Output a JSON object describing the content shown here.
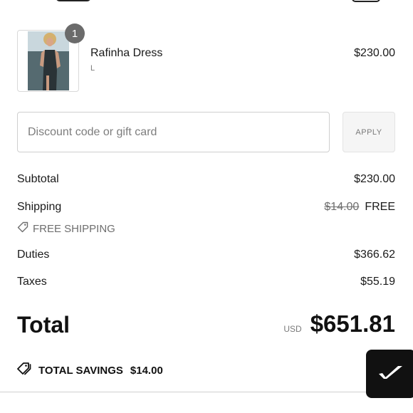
{
  "product": {
    "name": "Rafinha Dress",
    "variant": "L",
    "price": "$230.00",
    "quantity": "1"
  },
  "discount": {
    "placeholder": "Discount code or gift card",
    "value": "",
    "apply_label": "APPLY"
  },
  "summary": {
    "subtotal_label": "Subtotal",
    "subtotal_value": "$230.00",
    "shipping_label": "Shipping",
    "shipping_original": "$14.00",
    "shipping_value": "FREE",
    "free_shipping_tag": "FREE SHIPPING",
    "duties_label": "Duties",
    "duties_value": "$366.62",
    "taxes_label": "Taxes",
    "taxes_value": "$55.19"
  },
  "total": {
    "label": "Total",
    "currency": "USD",
    "amount": "$651.81"
  },
  "savings": {
    "label": "TOTAL SAVINGS",
    "amount": "$14.00"
  },
  "icons": {
    "tag": "tag-icon",
    "floating": "checkmark-logo-icon"
  }
}
